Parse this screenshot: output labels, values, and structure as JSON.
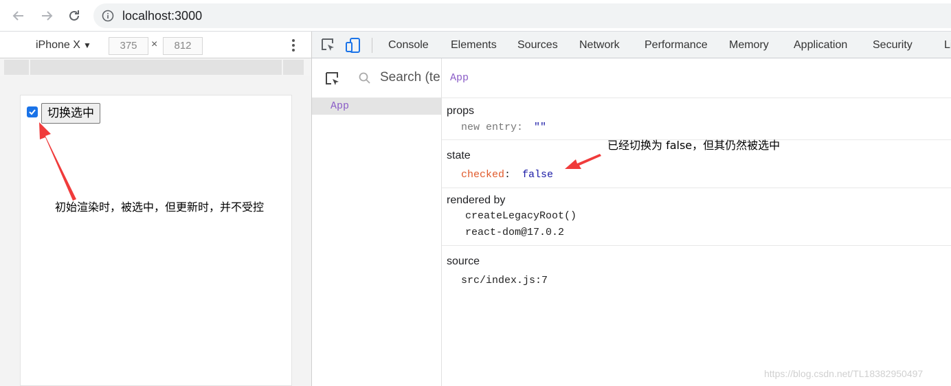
{
  "browser": {
    "url": "localhost:3000"
  },
  "device_toolbar": {
    "device": "iPhone X",
    "width": "375",
    "separator": "×",
    "height": "812"
  },
  "page": {
    "button_label": "切换选中",
    "checkbox_checked": true
  },
  "annotations": {
    "left": "初始渲染时，被选中，但更新时，并不受控",
    "right": "已经切换为 false，但其仍然被选中",
    "arrow_color": "#f03b3b"
  },
  "devtools": {
    "tabs": [
      "Console",
      "Elements",
      "Sources",
      "Network",
      "Performance",
      "Memory",
      "Application",
      "Security",
      "Li"
    ],
    "search_placeholder": "Search (te",
    "tree_item": "App",
    "selected_component": "App",
    "props": {
      "heading": "props",
      "key": "new entry",
      "colon": ":",
      "value": "\"\""
    },
    "state": {
      "heading": "state",
      "key": "checked",
      "colon": ":",
      "value": "false"
    },
    "rendered_by": {
      "heading": "rendered by",
      "items": [
        "createLegacyRoot()",
        "react-dom@17.0.2"
      ]
    },
    "source": {
      "heading": "source",
      "value": "src/index.js:7"
    }
  },
  "watermark": "https://blog.csdn.net/TL18382950497",
  "colors": {
    "accent_blue": "#1a73e8",
    "react_purple": "#8a5cc7",
    "state_key_orange": "#e0592a"
  }
}
